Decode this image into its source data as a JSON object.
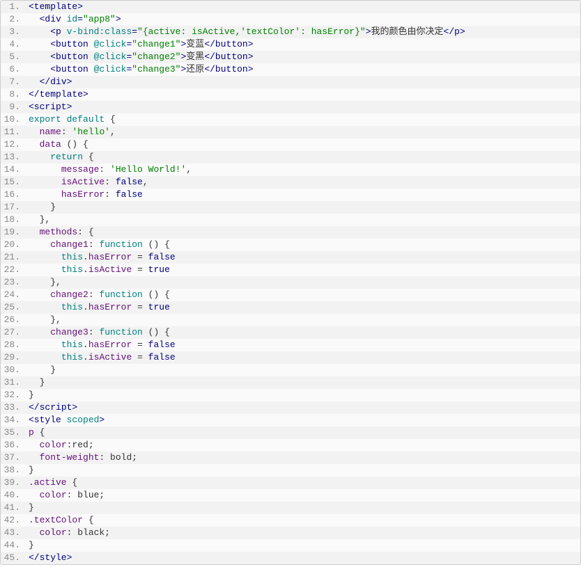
{
  "lines": [
    {
      "n": "1.",
      "segs": [
        [
          "c-tag",
          "<template>"
        ]
      ]
    },
    {
      "n": "2.",
      "segs": [
        [
          "c-text",
          "  "
        ],
        [
          "c-tag",
          "<div "
        ],
        [
          "c-attr",
          "id"
        ],
        [
          "c-tag",
          "="
        ],
        [
          "c-str",
          "\"app8\""
        ],
        [
          "c-tag",
          ">"
        ]
      ]
    },
    {
      "n": "3.",
      "segs": [
        [
          "c-text",
          "    "
        ],
        [
          "c-tag",
          "<p "
        ],
        [
          "c-attr",
          "v-bind:class"
        ],
        [
          "c-tag",
          "="
        ],
        [
          "c-str",
          "\"{active: isActive,'textColor': hasError}\""
        ],
        [
          "c-tag",
          ">"
        ],
        [
          "c-text",
          "我的颜色由你决定"
        ],
        [
          "c-tag",
          "</p>"
        ]
      ]
    },
    {
      "n": "4.",
      "segs": [
        [
          "c-text",
          "    "
        ],
        [
          "c-tag",
          "<button "
        ],
        [
          "c-attr",
          "@click"
        ],
        [
          "c-tag",
          "="
        ],
        [
          "c-str",
          "\"change1\""
        ],
        [
          "c-tag",
          ">"
        ],
        [
          "c-text",
          "变蓝"
        ],
        [
          "c-tag",
          "</button>"
        ]
      ]
    },
    {
      "n": "5.",
      "segs": [
        [
          "c-text",
          "    "
        ],
        [
          "c-tag",
          "<button "
        ],
        [
          "c-attr",
          "@click"
        ],
        [
          "c-tag",
          "="
        ],
        [
          "c-str",
          "\"change2\""
        ],
        [
          "c-tag",
          ">"
        ],
        [
          "c-text",
          "变黑"
        ],
        [
          "c-tag",
          "</button>"
        ]
      ]
    },
    {
      "n": "6.",
      "segs": [
        [
          "c-text",
          "    "
        ],
        [
          "c-tag",
          "<button "
        ],
        [
          "c-attr",
          "@click"
        ],
        [
          "c-tag",
          "="
        ],
        [
          "c-str",
          "\"change3\""
        ],
        [
          "c-tag",
          ">"
        ],
        [
          "c-text",
          "还原"
        ],
        [
          "c-tag",
          "</button>"
        ]
      ]
    },
    {
      "n": "7.",
      "segs": [
        [
          "c-text",
          "  "
        ],
        [
          "c-tag",
          "</div>"
        ]
      ]
    },
    {
      "n": "8.",
      "segs": [
        [
          "c-tag",
          "</template>"
        ]
      ]
    },
    {
      "n": "9.",
      "segs": [
        [
          "c-tag",
          "<script>"
        ]
      ]
    },
    {
      "n": "10.",
      "segs": [
        [
          "c-kw",
          "export"
        ],
        [
          "c-text",
          " "
        ],
        [
          "c-kw",
          "default"
        ],
        [
          "c-text",
          " {"
        ]
      ]
    },
    {
      "n": "11.",
      "segs": [
        [
          "c-text",
          "  "
        ],
        [
          "c-prop",
          "name"
        ],
        [
          "c-text",
          ": "
        ],
        [
          "c-str",
          "'hello'"
        ],
        [
          "c-text",
          ","
        ]
      ]
    },
    {
      "n": "12.",
      "segs": [
        [
          "c-text",
          "  "
        ],
        [
          "c-prop",
          "data"
        ],
        [
          "c-text",
          " () {"
        ]
      ]
    },
    {
      "n": "13.",
      "segs": [
        [
          "c-text",
          "    "
        ],
        [
          "c-kw",
          "return"
        ],
        [
          "c-text",
          " {"
        ]
      ]
    },
    {
      "n": "14.",
      "segs": [
        [
          "c-text",
          "      "
        ],
        [
          "c-prop",
          "message"
        ],
        [
          "c-text",
          ": "
        ],
        [
          "c-str",
          "'Hello World!'"
        ],
        [
          "c-text",
          ","
        ]
      ]
    },
    {
      "n": "15.",
      "segs": [
        [
          "c-text",
          "      "
        ],
        [
          "c-prop",
          "isActive"
        ],
        [
          "c-text",
          ": "
        ],
        [
          "c-lit",
          "false"
        ],
        [
          "c-text",
          ","
        ]
      ]
    },
    {
      "n": "16.",
      "segs": [
        [
          "c-text",
          "      "
        ],
        [
          "c-prop",
          "hasError"
        ],
        [
          "c-text",
          ": "
        ],
        [
          "c-lit",
          "false"
        ]
      ]
    },
    {
      "n": "17.",
      "segs": [
        [
          "c-text",
          "    }"
        ]
      ]
    },
    {
      "n": "18.",
      "segs": [
        [
          "c-text",
          "  },"
        ]
      ]
    },
    {
      "n": "19.",
      "segs": [
        [
          "c-text",
          "  "
        ],
        [
          "c-prop",
          "methods"
        ],
        [
          "c-text",
          ": {"
        ]
      ]
    },
    {
      "n": "20.",
      "segs": [
        [
          "c-text",
          "    "
        ],
        [
          "c-prop",
          "change1"
        ],
        [
          "c-text",
          ": "
        ],
        [
          "c-kw",
          "function"
        ],
        [
          "c-text",
          " () {"
        ]
      ]
    },
    {
      "n": "21.",
      "segs": [
        [
          "c-text",
          "      "
        ],
        [
          "c-kw",
          "this"
        ],
        [
          "c-text",
          "."
        ],
        [
          "c-prop",
          "hasError"
        ],
        [
          "c-text",
          " = "
        ],
        [
          "c-lit",
          "false"
        ]
      ]
    },
    {
      "n": "22.",
      "segs": [
        [
          "c-text",
          "      "
        ],
        [
          "c-kw",
          "this"
        ],
        [
          "c-text",
          "."
        ],
        [
          "c-prop",
          "isActive"
        ],
        [
          "c-text",
          " = "
        ],
        [
          "c-lit",
          "true"
        ]
      ]
    },
    {
      "n": "23.",
      "segs": [
        [
          "c-text",
          "    },"
        ]
      ]
    },
    {
      "n": "24.",
      "segs": [
        [
          "c-text",
          "    "
        ],
        [
          "c-prop",
          "change2"
        ],
        [
          "c-text",
          ": "
        ],
        [
          "c-kw",
          "function"
        ],
        [
          "c-text",
          " () {"
        ]
      ]
    },
    {
      "n": "25.",
      "segs": [
        [
          "c-text",
          "      "
        ],
        [
          "c-kw",
          "this"
        ],
        [
          "c-text",
          "."
        ],
        [
          "c-prop",
          "hasError"
        ],
        [
          "c-text",
          " = "
        ],
        [
          "c-lit",
          "true"
        ]
      ]
    },
    {
      "n": "26.",
      "segs": [
        [
          "c-text",
          "    },"
        ]
      ]
    },
    {
      "n": "27.",
      "segs": [
        [
          "c-text",
          "    "
        ],
        [
          "c-prop",
          "change3"
        ],
        [
          "c-text",
          ": "
        ],
        [
          "c-kw",
          "function"
        ],
        [
          "c-text",
          " () {"
        ]
      ]
    },
    {
      "n": "28.",
      "segs": [
        [
          "c-text",
          "      "
        ],
        [
          "c-kw",
          "this"
        ],
        [
          "c-text",
          "."
        ],
        [
          "c-prop",
          "hasError"
        ],
        [
          "c-text",
          " = "
        ],
        [
          "c-lit",
          "false"
        ]
      ]
    },
    {
      "n": "29.",
      "segs": [
        [
          "c-text",
          "      "
        ],
        [
          "c-kw",
          "this"
        ],
        [
          "c-text",
          "."
        ],
        [
          "c-prop",
          "isActive"
        ],
        [
          "c-text",
          " = "
        ],
        [
          "c-lit",
          "false"
        ]
      ]
    },
    {
      "n": "30.",
      "segs": [
        [
          "c-text",
          "    }"
        ]
      ]
    },
    {
      "n": "31.",
      "segs": [
        [
          "c-text",
          "  }"
        ]
      ]
    },
    {
      "n": "32.",
      "segs": [
        [
          "c-text",
          "}"
        ]
      ]
    },
    {
      "n": "33.",
      "segs": [
        [
          "c-tag",
          "</scr"
        ],
        [
          "c-tag",
          "ipt>"
        ]
      ]
    },
    {
      "n": "34.",
      "segs": [
        [
          "c-tag",
          "<style "
        ],
        [
          "c-attr",
          "scoped"
        ],
        [
          "c-tag",
          ">"
        ]
      ]
    },
    {
      "n": "35.",
      "segs": [
        [
          "c-prop",
          "p"
        ],
        [
          "c-text",
          " {"
        ]
      ]
    },
    {
      "n": "36.",
      "segs": [
        [
          "c-text",
          "  "
        ],
        [
          "c-prop",
          "color"
        ],
        [
          "c-text",
          ":red;"
        ]
      ]
    },
    {
      "n": "37.",
      "segs": [
        [
          "c-text",
          "  "
        ],
        [
          "c-prop",
          "font-weight"
        ],
        [
          "c-text",
          ": bold;"
        ]
      ]
    },
    {
      "n": "38.",
      "segs": [
        [
          "c-text",
          "}"
        ]
      ]
    },
    {
      "n": "39.",
      "segs": [
        [
          "c-prop",
          ".active"
        ],
        [
          "c-text",
          " {"
        ]
      ]
    },
    {
      "n": "40.",
      "segs": [
        [
          "c-text",
          "  "
        ],
        [
          "c-prop",
          "color"
        ],
        [
          "c-text",
          ": blue;"
        ]
      ]
    },
    {
      "n": "41.",
      "segs": [
        [
          "c-text",
          "}"
        ]
      ]
    },
    {
      "n": "42.",
      "segs": [
        [
          "c-prop",
          ".textColor"
        ],
        [
          "c-text",
          " {"
        ]
      ]
    },
    {
      "n": "43.",
      "segs": [
        [
          "c-text",
          "  "
        ],
        [
          "c-prop",
          "color"
        ],
        [
          "c-text",
          ": black;"
        ]
      ]
    },
    {
      "n": "44.",
      "segs": [
        [
          "c-text",
          "}"
        ]
      ]
    },
    {
      "n": "45.",
      "segs": [
        [
          "c-tag",
          "</style>"
        ]
      ]
    }
  ]
}
